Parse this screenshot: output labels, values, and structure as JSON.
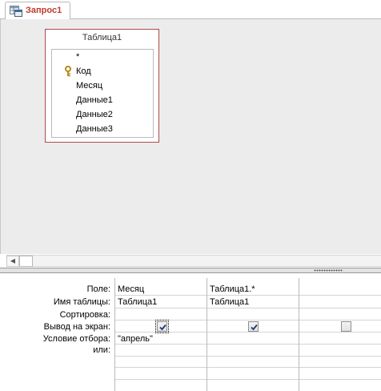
{
  "tab": {
    "label": "Запрос1",
    "icon": "query-design-icon"
  },
  "table_box": {
    "title": "Таблица1",
    "fields": [
      "*",
      "Код",
      "Месяц",
      "Данные1",
      "Данные2",
      "Данные3"
    ],
    "key_field": "Код"
  },
  "grid": {
    "row_labels": [
      "Поле:",
      "Имя таблицы:",
      "Сортировка:",
      "Вывод на экран:",
      "Условие отбора:",
      "или:"
    ],
    "columns": [
      {
        "field": "Месяц",
        "table": "Таблица1",
        "sort": "",
        "show": true,
        "criteria": "\"апрель\"",
        "or": ""
      },
      {
        "field": "Таблица1.*",
        "table": "Таблица1",
        "sort": "",
        "show": true,
        "criteria": "",
        "or": ""
      },
      {
        "field": "",
        "table": "",
        "sort": "",
        "show": false,
        "criteria": "",
        "or": ""
      }
    ]
  },
  "colors": {
    "tab_text": "#c0392b",
    "table_border": "#b04a4a",
    "pane_bg": "#ececec"
  }
}
